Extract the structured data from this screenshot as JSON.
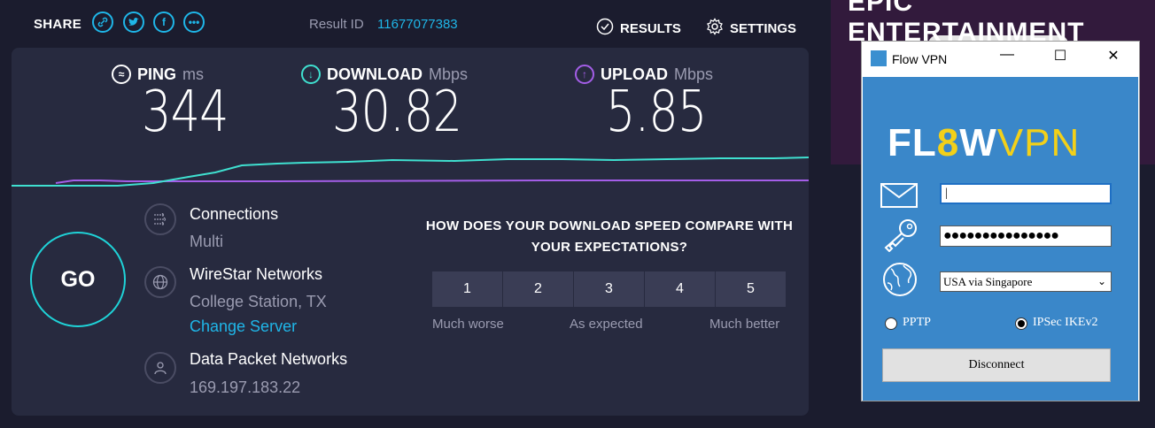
{
  "speedtest": {
    "share_label": "SHARE",
    "share_icons": [
      "link-icon",
      "twitter-icon",
      "facebook-icon",
      "more-icon"
    ],
    "result_label": "Result ID",
    "result_id": "11677077383",
    "results_label": "RESULTS",
    "settings_label": "SETTINGS",
    "ping": {
      "label": "PING",
      "unit": "ms",
      "value": "344"
    },
    "download": {
      "label": "DOWNLOAD",
      "unit": "Mbps",
      "value": "30.82"
    },
    "upload": {
      "label": "UPLOAD",
      "unit": "Mbps",
      "value": "5.85"
    },
    "go_label": "GO",
    "connections": {
      "title": "Connections",
      "value": "Multi"
    },
    "host": {
      "title": "WireStar Networks",
      "location": "College Station, TX",
      "change_link": "Change Server"
    },
    "isp": {
      "title": "Data Packet Networks",
      "ip": "169.197.183.22"
    },
    "question": "HOW DOES YOUR DOWNLOAD SPEED COMPARE WITH YOUR EXPECTATIONS?",
    "ratings": [
      "1",
      "2",
      "3",
      "4",
      "5"
    ],
    "rating_low": "Much worse",
    "rating_mid": "As expected",
    "rating_high": "Much better",
    "colors": {
      "accent": "#1fb6e8",
      "download_line": "#3fe0d0",
      "upload_line": "#a45ee8",
      "card": "#272a3f"
    }
  },
  "ad": {
    "text": "EPIC ENTERTAINMENT"
  },
  "vpn": {
    "window_title": "Flow VPN",
    "logo_text_a": "FL",
    "logo_text_b": "W",
    "logo_text_c": "VPN",
    "username_value": "",
    "password_value": "●●●●●●●●●●●●●●●",
    "server_selected": "USA via Singapore",
    "protocol_options": [
      "PPTP",
      "IPSec IKEv2"
    ],
    "protocol_selected": "IPSec IKEv2",
    "disconnect_label": "Disconnect",
    "icons": [
      "mail-icon",
      "key-icon",
      "globe-icon"
    ]
  }
}
